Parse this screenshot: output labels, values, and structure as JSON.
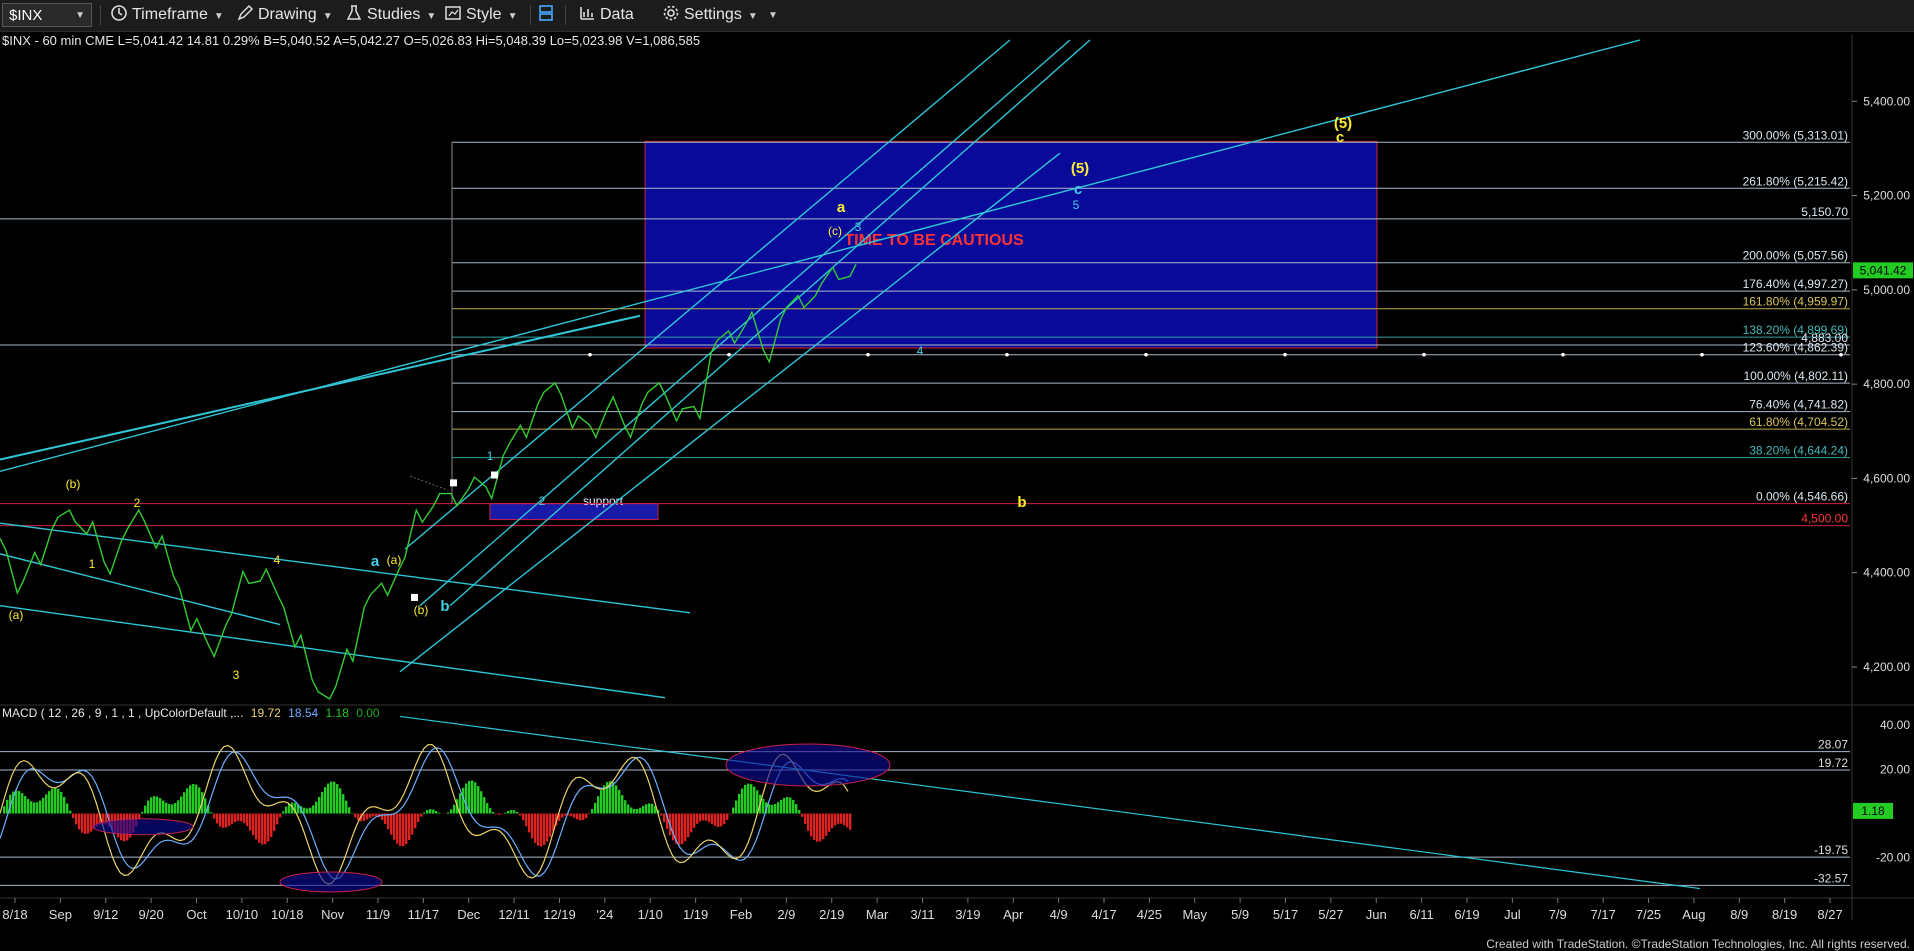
{
  "toolbar": {
    "symbol": "$INX",
    "timeframe": "Timeframe",
    "drawing": "Drawing",
    "studies": "Studies",
    "style": "Style",
    "data": "Data",
    "settings": "Settings"
  },
  "status_line": {
    "symbol": "$INX - 60 min",
    "exchange": "CME",
    "last": "L=5,041.42",
    "change": "14.81",
    "pct": "0.29%",
    "bid": "B=5,040.52",
    "ask": "A=5,042.27",
    "open": "O=5,026.83",
    "high": "Hi=5,048.39",
    "low": "Lo=5,023.98",
    "volume": "V=1,086,585"
  },
  "macd_line": {
    "label": "MACD ( 12 , 26 , 9 , 1 , 1 , UpColorDefault ,...",
    "v1": "19.72",
    "v2": "18.54",
    "v3": "1.18",
    "v4": "0.00"
  },
  "footer": "Created with TradeStation. ©TradeStation Technologies, Inc. All rights reserved.",
  "chart_data": {
    "type": "line",
    "price_axis": {
      "ylim": [
        4130,
        5530
      ],
      "ticks": [
        "4,200.00",
        "4,400.00",
        "4,600.00",
        "4,800.00",
        "5,000.00",
        "5,200.00",
        "5,400.00"
      ],
      "tick_values": [
        4200,
        4400,
        4600,
        4800,
        5000,
        5200,
        5400
      ],
      "last_price_label": "5,041.42",
      "last_price": 5041.42
    },
    "x_axis": {
      "tick_labels": [
        "8/18",
        "Sep",
        "9/12",
        "9/20",
        "Oct",
        "10/10",
        "10/18",
        "Nov",
        "11/9",
        "11/17",
        "Dec",
        "12/11",
        "12/19",
        "'24",
        "1/10",
        "1/19",
        "Feb",
        "2/9",
        "2/19",
        "Mar",
        "3/11",
        "3/19",
        "Apr",
        "4/9",
        "4/17",
        "4/25",
        "May",
        "5/9",
        "5/17",
        "5/27",
        "Jun",
        "6/11",
        "6/19",
        "Jul",
        "7/9",
        "7/17",
        "7/25",
        "Aug",
        "8/9",
        "8/19",
        "8/27"
      ]
    },
    "series": [
      {
        "color": "#33cc33",
        "x_index": [
          0,
          1,
          2,
          3,
          4,
          5,
          6,
          7,
          8,
          9,
          10,
          11,
          12,
          13,
          14,
          15,
          16,
          17,
          18,
          19,
          20,
          21,
          22,
          23,
          24,
          25,
          26,
          27,
          28,
          29,
          30,
          31,
          32,
          33,
          34
        ],
        "values": [
          4460,
          4370,
          4430,
          4505,
          4520,
          4495,
          4410,
          4480,
          4520,
          4465,
          4380,
          4290,
          4235,
          4300,
          4390,
          4395,
          4340,
          4255,
          4160,
          4145,
          4225,
          4340,
          4365,
          4420,
          4520,
          4555,
          4555,
          4590,
          4570,
          4660,
          4700,
          4770,
          4790,
          4720,
          4700
        ]
      }
    ],
    "series_tail": {
      "values": [
        4760,
        4700,
        4770,
        4790,
        4735,
        4740,
        4880,
        4900,
        4940,
        4860,
        4950,
        4975,
        5000,
        5035,
        5041.42
      ]
    },
    "fibonacci_levels": [
      {
        "label": "300.00% (5,313.01)",
        "value": 5313.01
      },
      {
        "label": "261.80% (5,215.42)",
        "value": 5215.42
      },
      {
        "label": "5,150.70",
        "value": 5150.7
      },
      {
        "label": "200.00% (5,057.56)",
        "value": 5057.56
      },
      {
        "label": "176.40% (4,997.27)",
        "value": 4997.27
      },
      {
        "label": "161.80% (4,959.97)",
        "value": 4959.97
      },
      {
        "label": "138.20% (4,899.69)",
        "value": 4899.69
      },
      {
        "label": "4,883.00",
        "value": 4883.0
      },
      {
        "label": "123.60% (4,862.39)",
        "value": 4862.39
      },
      {
        "label": "100.00% (4,802.11)",
        "value": 4802.11
      },
      {
        "label": "76.40% (4,741.82)",
        "value": 4741.82
      },
      {
        "label": "61.80% (4,704.52)",
        "value": 4704.52
      },
      {
        "label": "38.20% (4,644.24)",
        "value": 4644.24
      },
      {
        "label": "0.00% (4,546.66)",
        "value": 4546.66
      },
      {
        "label": "4,500.00",
        "value": 4500.0
      }
    ],
    "annotations": {
      "caution": "TIME TO BE CAUTIOUS",
      "support": "support",
      "wave_labels": [
        "(a)",
        "(b)",
        "1",
        "2",
        "3",
        "4",
        "a",
        "(a)",
        "(b)",
        "b",
        "1",
        "2",
        "3",
        "4",
        "5",
        "a",
        "(c)",
        "c",
        "(5)",
        "(5)",
        "c",
        "b"
      ]
    },
    "macd_axis": {
      "ticks": [
        "40.00",
        "20.00",
        "-20.00"
      ],
      "tick_values": [
        40,
        20,
        -20
      ],
      "levels": [
        {
          "label": "28.07",
          "value": 28.07
        },
        {
          "label": "19.72",
          "value": 19.72
        },
        {
          "label": "-19.75",
          "value": -19.75
        },
        {
          "label": "-32.57",
          "value": -32.57
        }
      ],
      "last_label": "1.18",
      "last_value": 1.18,
      "ylim": [
        -36,
        46
      ]
    },
    "colors": {
      "price": "#33cc33",
      "channel": "#2fc6d6",
      "fib": "#9fb3c8",
      "support": "#cc2244",
      "box": "#0a0a9a",
      "macd": "#e8d36a",
      "signal": "#69b0ff",
      "hist_up": "#22cc22",
      "hist_down": "#dd2222",
      "label_yellow": "#ffee33",
      "label_cyan": "#43d0e6"
    }
  }
}
